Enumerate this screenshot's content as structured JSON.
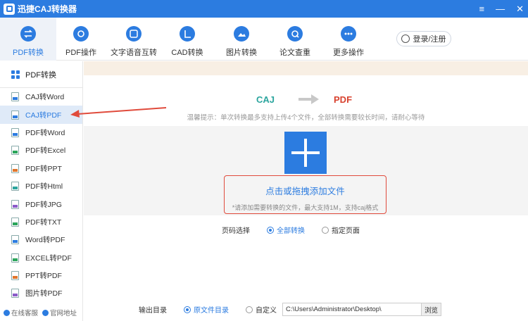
{
  "window": {
    "title": "迅捷CAJ转换器",
    "controls": [
      "≡",
      "—",
      "✕"
    ]
  },
  "toolbar": {
    "items": [
      {
        "label": "PDF转换",
        "icon": "swap-icon",
        "active": true
      },
      {
        "label": "PDF操作",
        "icon": "gear-icon",
        "active": false
      },
      {
        "label": "文字语音互转",
        "icon": "voice-icon",
        "active": false
      },
      {
        "label": "CAD转换",
        "icon": "cad-icon",
        "active": false
      },
      {
        "label": "图片转换",
        "icon": "image-icon",
        "active": false
      },
      {
        "label": "论文查重",
        "icon": "doc-check-icon",
        "active": false
      },
      {
        "label": "更多操作",
        "icon": "more-icon",
        "active": false
      }
    ],
    "login": "登录/注册"
  },
  "sidebar": {
    "header": "PDF转换",
    "items": [
      {
        "label": "CAJ转Word",
        "color": "#2c7ce0"
      },
      {
        "label": "CAJ转PDF",
        "color": "#2c7ce0",
        "active": true
      },
      {
        "label": "PDF转Word",
        "color": "#2c7ce0"
      },
      {
        "label": "PDF转Excel",
        "color": "#2aa55a"
      },
      {
        "label": "PDF转PPT",
        "color": "#e0762c"
      },
      {
        "label": "PDF转Html",
        "color": "#2ba59e"
      },
      {
        "label": "PDF转JPG",
        "color": "#8a5cc8"
      },
      {
        "label": "PDF转TXT",
        "color": "#2aa55a"
      },
      {
        "label": "Word转PDF",
        "color": "#2c7ce0"
      },
      {
        "label": "EXCEL转PDF",
        "color": "#2aa55a"
      },
      {
        "label": "PPT转PDF",
        "color": "#e0762c"
      },
      {
        "label": "图片转PDF",
        "color": "#8a5cc8"
      }
    ],
    "footer": {
      "service": "在线客服",
      "website": "官网地址"
    }
  },
  "main": {
    "from": "CAJ",
    "to": "PDF",
    "tip": "温馨提示：单次转换最多支持上传4个文件，全部转换需要较长时间，请耐心等待",
    "drop_title": "点击或拖拽添加文件",
    "drop_sub": "*请添加需要转换的文件，最大支持1M，支持caj格式",
    "pages_label": "页码选择",
    "pages_all": "全部转换",
    "pages_specific": "指定页面",
    "output_label": "输出目录",
    "output_original": "原文件目录",
    "output_custom": "自定义",
    "output_path": "C:\\Users\\Administrator\\Desktop\\",
    "browse": "浏览"
  }
}
